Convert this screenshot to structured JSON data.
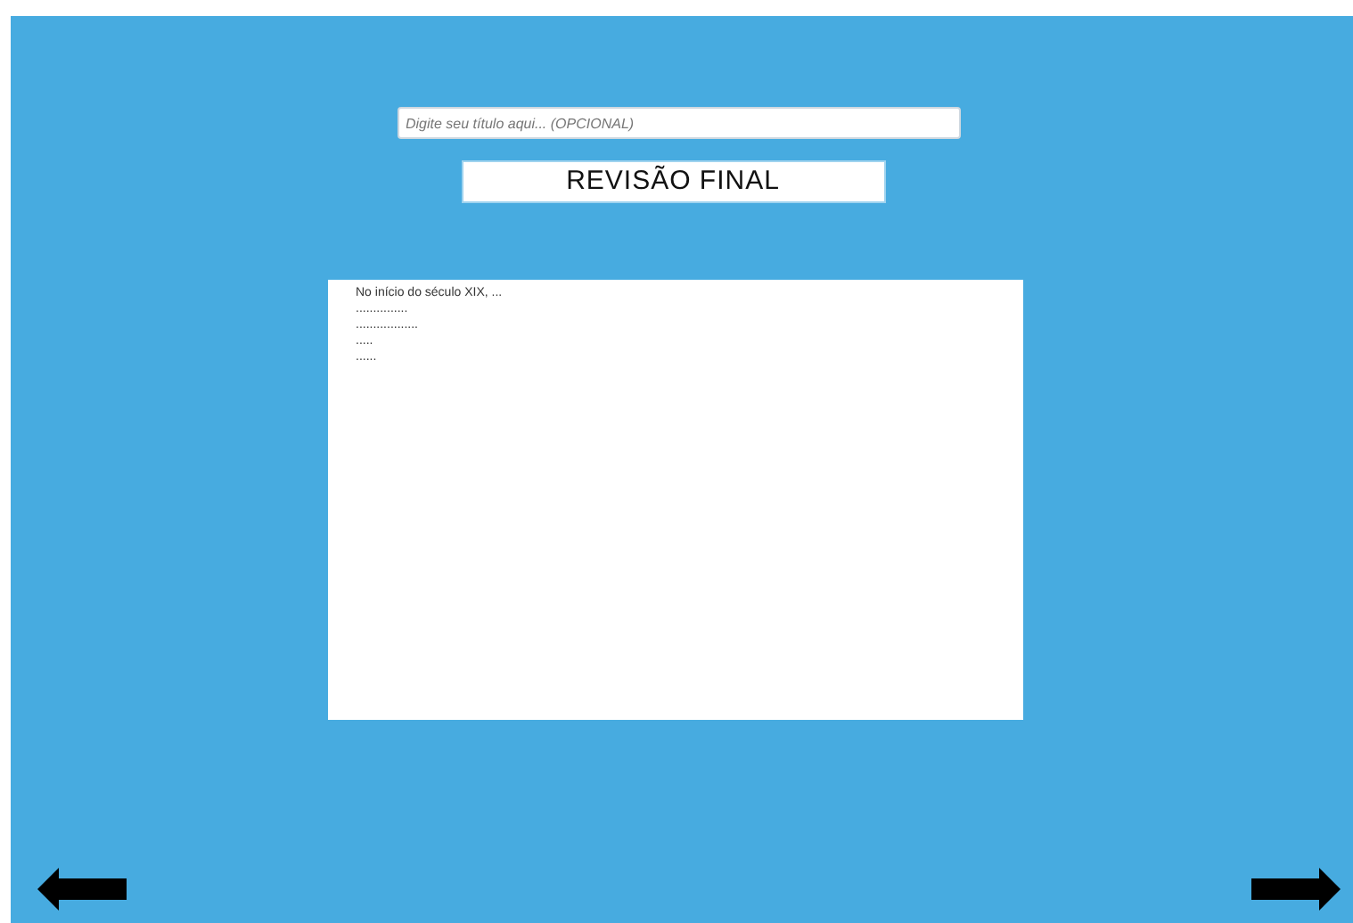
{
  "title_field": {
    "placeholder": "Digite seu título aqui... (OPCIONAL)"
  },
  "heading": "REVISÃO FINAL",
  "text_lines": [
    "No início do século XIX, ...",
    "...............",
    "..................",
    ".....",
    "......"
  ]
}
